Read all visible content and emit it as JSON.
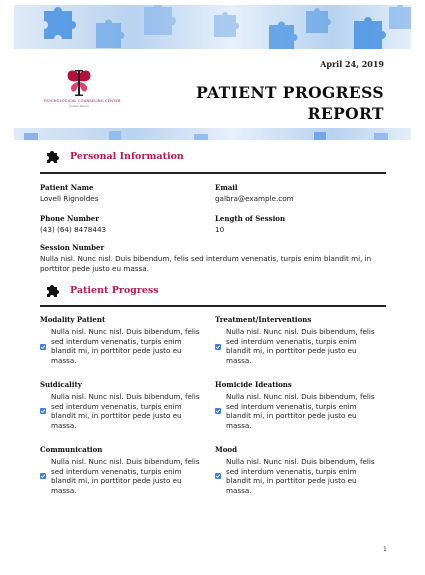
{
  "header": {
    "date": "April 24, 2019",
    "title_line1": "PATIENT PROGRESS",
    "title_line2": "REPORT",
    "logo_org": "PSYCHOLOGICAL COUNSELING CENTER",
    "logo_tagline": "Lorem Ipsum",
    "logo_icon": "butterfly-logo-icon"
  },
  "colors": {
    "accent": "#c0174f",
    "check": "#3f7fe3",
    "banner_piece": "#4f96e3"
  },
  "personal": {
    "heading": "Personal Information",
    "icon": "puzzle-piece-icon",
    "patient_name_label": "Patient Name",
    "patient_name": "Lovell Rignoldes",
    "email_label": "Email",
    "email": "galbra@example.com",
    "phone_label": "Phone Number",
    "phone": "(43) (64) 8478443",
    "length_label": "Length of Session",
    "length": "10",
    "session_label": "Session Number",
    "session_text": "Nulla nisl. Nunc nisl. Duis bibendum, felis sed interdum venenatis, turpis enim blandit mi, in porttitor pede justo eu massa."
  },
  "progress": {
    "heading": "Patient Progress",
    "icon": "puzzle-piece-icon",
    "items": [
      {
        "label": "Modality Patient",
        "text": "Nulla nisl. Nunc nisl. Duis bibendum, felis sed interdum venenatis, turpis enim blandit mi, in porttitor pede justo eu massa.",
        "checked": true
      },
      {
        "label": "Treatment/Interventions",
        "text": "Nulla nisl. Nunc nisl. Duis bibendum, felis sed interdum venenatis, turpis enim blandit mi, in porttitor pede justo eu massa.",
        "checked": true
      },
      {
        "label": "Suidicality",
        "text": "Nulla nisl. Nunc nisl. Duis bibendum, felis sed interdum venenatis, turpis enim blandit mi, in porttitor pede justo eu massa.",
        "checked": true
      },
      {
        "label": "Homicide Ideations",
        "text": "Nulla nisl. Nunc nisl. Duis bibendum, felis sed interdum venenatis, turpis enim blandit mi, in porttitor pede justo eu massa.",
        "checked": true
      },
      {
        "label": "Communication",
        "text": "Nulla nisl. Nunc nisl. Duis bibendum, felis sed interdum venenatis, turpis enim blandit mi, in porttitor pede justo eu massa.",
        "checked": true
      },
      {
        "label": "Mood",
        "text": "Nulla nisl. Nunc nisl. Duis bibendum, felis sed interdum venenatis, turpis enim blandit mi, in porttitor pede justo eu massa.",
        "checked": true
      }
    ]
  },
  "footer": {
    "page_number": "1"
  }
}
